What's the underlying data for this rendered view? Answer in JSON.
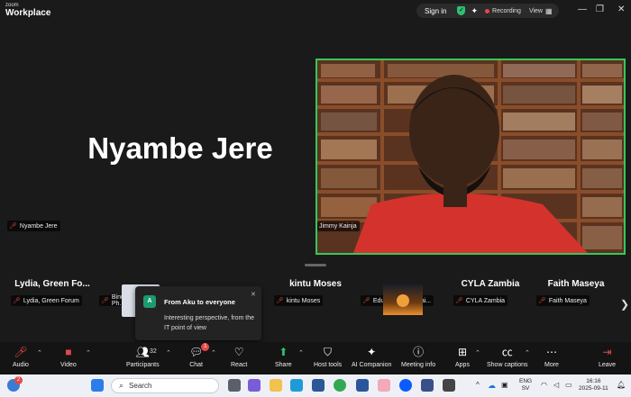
{
  "app": {
    "brand_top": "zoom",
    "brand_main": "Workplace"
  },
  "titlebar": {
    "signin": "Sign in",
    "recording": "Recording",
    "view": "View",
    "controls": [
      "—",
      "❐",
      "✕"
    ]
  },
  "main": {
    "speaker_name": "Nyambe Jere",
    "speaker_tag": "Nyambe Jere",
    "video_tag": "Jimmy Kainja"
  },
  "strip": {
    "tiles": [
      {
        "name": "Lydia,  Green  Fo...",
        "tag": "Lydia, Green Forum"
      },
      {
        "name": "",
        "tag": "Binuel Ph..."
      },
      {
        "name": "kintu Moses",
        "tag": "kintu Moses"
      },
      {
        "name": "",
        "tag": "Education and Trai..."
      },
      {
        "name": "CYLA Zambia",
        "tag": "CYLA Zambia"
      },
      {
        "name": "Faith Maseya",
        "tag": "Faith Maseya"
      }
    ]
  },
  "chat_toast": {
    "avatar": "A",
    "title": "From Aku to everyone",
    "body": "Interesting perspective, from the IT point of view"
  },
  "toolbar": {
    "audio": "Audio",
    "video": "Video",
    "participants": "Participants",
    "participants_count": "32",
    "chat": "Chat",
    "chat_badge": "1",
    "react": "React",
    "share": "Share",
    "host_tools": "Host tools",
    "ai_companion": "AI Companion",
    "meeting_info": "Meeting info",
    "apps": "Apps",
    "show_captions": "Show captions",
    "more": "More",
    "leave": "Leave"
  },
  "taskbar": {
    "search_placeholder": "Search",
    "weather_badge": "2",
    "lang_top": "ENG",
    "lang_bottom": "SV",
    "time": "16:16",
    "date": "2025-09-11"
  },
  "colors": {
    "active_speaker": "#35c759",
    "mute_red": "#e34848",
    "share_green": "#2fbf71",
    "background": "#1a1a1a"
  }
}
